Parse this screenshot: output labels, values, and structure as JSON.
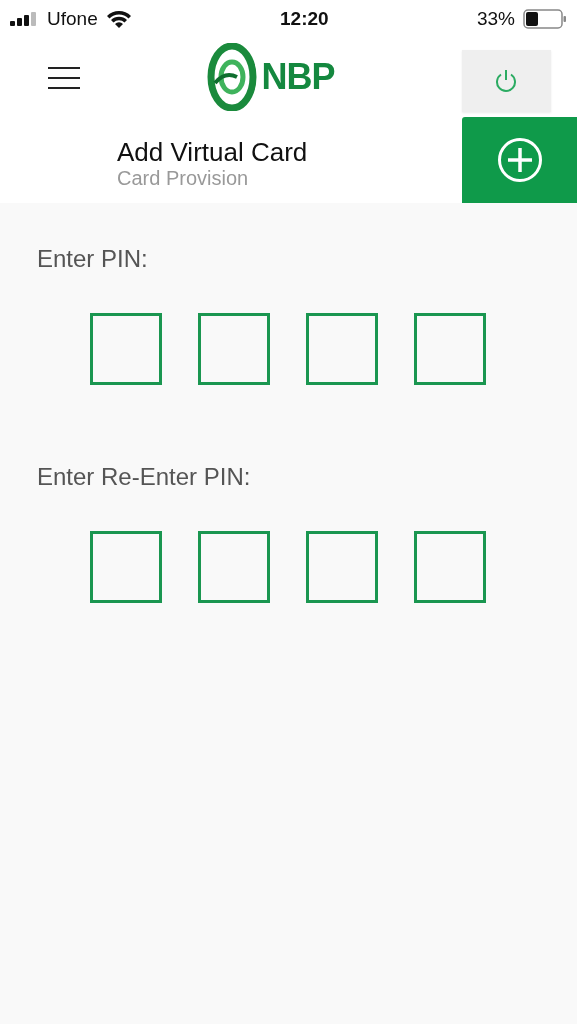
{
  "status_bar": {
    "carrier": "Ufone",
    "time": "12:20",
    "battery": "33%"
  },
  "header": {
    "logo_text": "NBP"
  },
  "page": {
    "title": "Add Virtual Card",
    "subtitle": "Card Provision"
  },
  "pin_groups": [
    {
      "label": "Enter PIN:"
    },
    {
      "label": "Enter Re-Enter PIN:"
    }
  ]
}
